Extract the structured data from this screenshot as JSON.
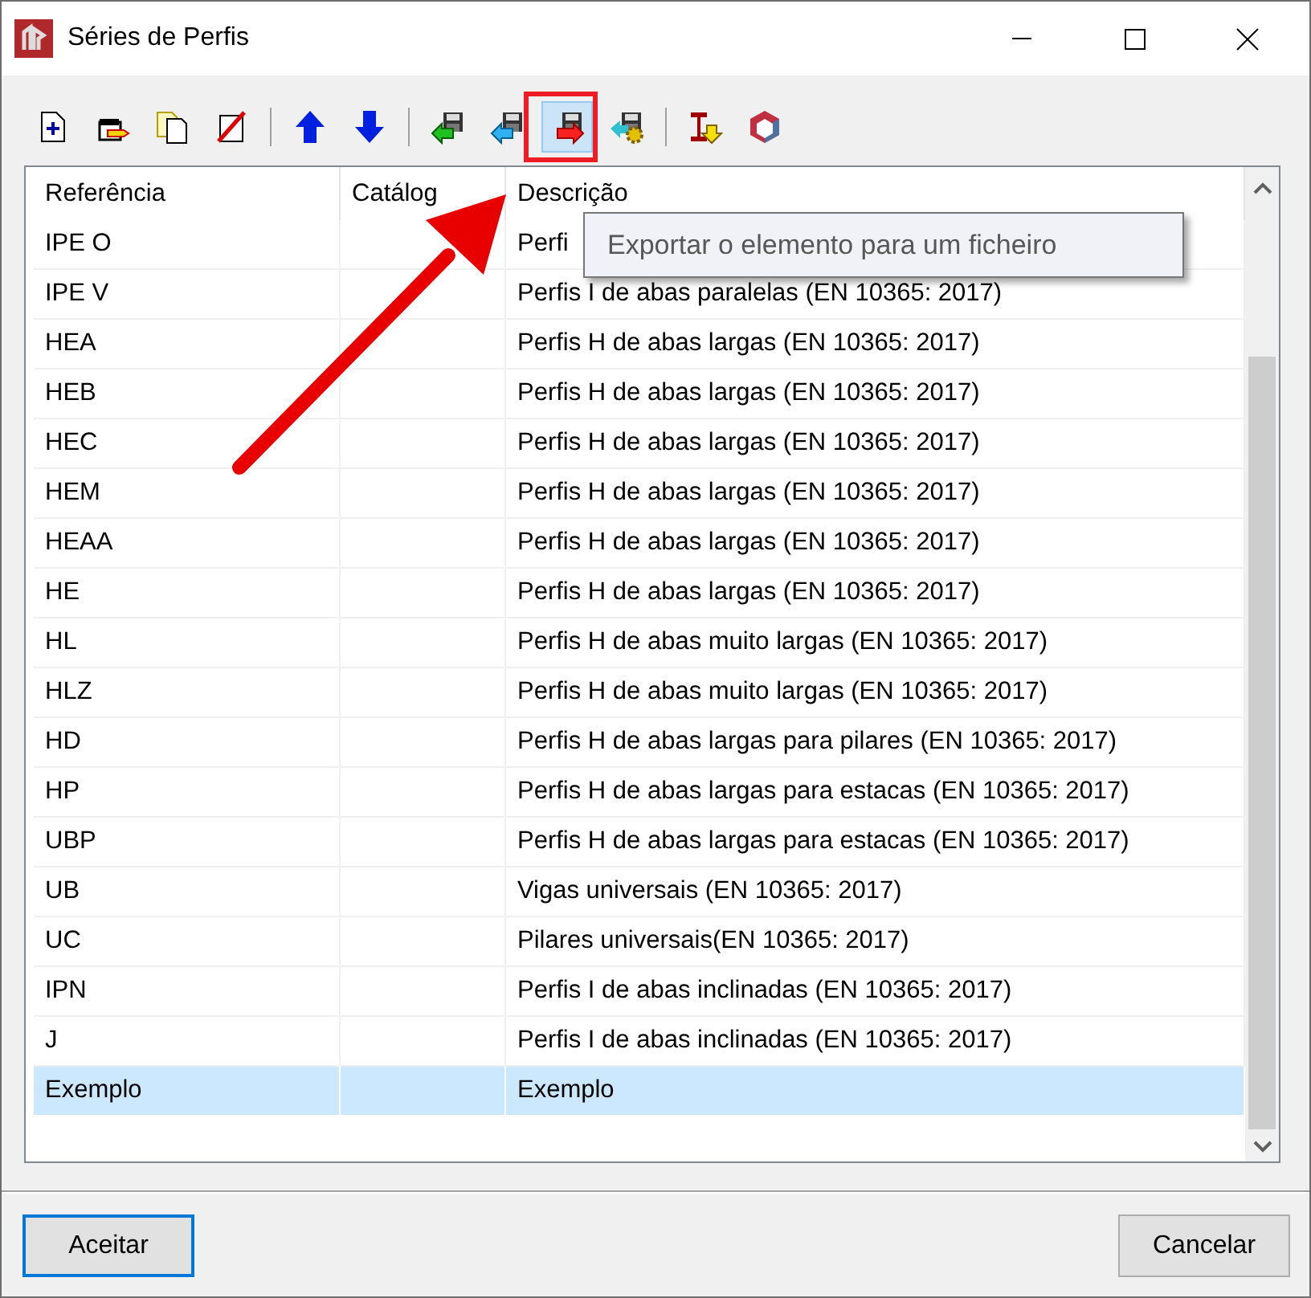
{
  "window": {
    "title": "Séries de Perfis"
  },
  "toolbar": [
    [
      {
        "kind": "new",
        "pressed": false
      },
      {
        "kind": "edit",
        "pressed": false
      },
      {
        "kind": "copy",
        "pressed": false
      },
      {
        "kind": "delete",
        "pressed": false
      }
    ],
    [
      {
        "kind": "up",
        "pressed": false
      },
      {
        "kind": "down",
        "pressed": false
      }
    ],
    [
      {
        "kind": "import-green",
        "pressed": false
      },
      {
        "kind": "import-cyan",
        "pressed": false
      },
      {
        "kind": "export",
        "pressed": true
      },
      {
        "kind": "settings",
        "pressed": false
      }
    ],
    [
      {
        "kind": "profile",
        "pressed": false
      },
      {
        "kind": "cube",
        "pressed": false
      }
    ]
  ],
  "tooltip": "Exportar o elemento para um ficheiro",
  "table": {
    "columns": [
      "Referência",
      "Catálog",
      "Descrição"
    ],
    "rows": [
      {
        "reference": "IPE O",
        "description": "Perfi",
        "selected": false
      },
      {
        "reference": "IPE V",
        "description": "Perfis I de abas paralelas (EN 10365: 2017)",
        "selected": false
      },
      {
        "reference": "HEA",
        "description": "Perfis H de abas largas (EN 10365: 2017)",
        "selected": false
      },
      {
        "reference": "HEB",
        "description": "Perfis H de abas largas (EN 10365: 2017)",
        "selected": false
      },
      {
        "reference": "HEC",
        "description": "Perfis H de abas largas (EN 10365: 2017)",
        "selected": false
      },
      {
        "reference": "HEM",
        "description": "Perfis H de abas largas (EN 10365: 2017)",
        "selected": false
      },
      {
        "reference": "HEAA",
        "description": "Perfis H de abas largas (EN 10365: 2017)",
        "selected": false
      },
      {
        "reference": "HE",
        "description": "Perfis H de abas largas (EN 10365: 2017)",
        "selected": false
      },
      {
        "reference": "HL",
        "description": "Perfis H de abas muito largas (EN 10365: 2017)",
        "selected": false
      },
      {
        "reference": "HLZ",
        "description": "Perfis H de abas muito largas (EN 10365: 2017)",
        "selected": false
      },
      {
        "reference": "HD",
        "description": "Perfis H de abas largas para pilares (EN 10365: 2017)",
        "selected": false
      },
      {
        "reference": "HP",
        "description": "Perfis H de abas largas para estacas (EN 10365: 2017)",
        "selected": false
      },
      {
        "reference": "UBP",
        "description": "Perfis H de abas largas para estacas (EN 10365: 2017)",
        "selected": false
      },
      {
        "reference": "UB",
        "description": "Vigas universais (EN 10365: 2017)",
        "selected": false
      },
      {
        "reference": "UC",
        "description": "Pilares universais(EN 10365: 2017)",
        "selected": false
      },
      {
        "reference": "IPN",
        "description": "Perfis I de abas inclinadas (EN 10365: 2017)",
        "selected": false
      },
      {
        "reference": "J",
        "description": "Perfis I de abas inclinadas (EN 10365: 2017)",
        "selected": false
      },
      {
        "reference": "Exemplo",
        "description": "Exemplo",
        "selected": true
      }
    ]
  },
  "buttons": [
    {
      "label": "Aceitar",
      "default": true
    },
    {
      "label": "Cancelar",
      "default": false
    }
  ]
}
